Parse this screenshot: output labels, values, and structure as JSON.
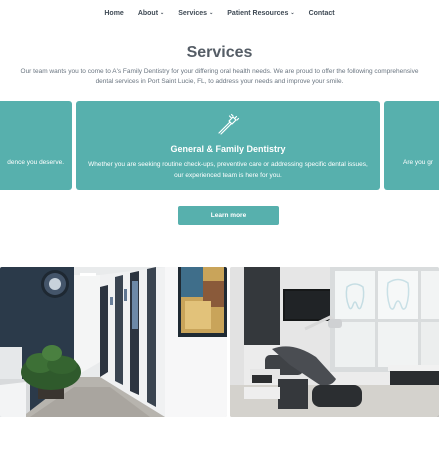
{
  "nav": {
    "items": [
      {
        "label": "Home",
        "has_dropdown": false
      },
      {
        "label": "About",
        "has_dropdown": true
      },
      {
        "label": "Services",
        "has_dropdown": true
      },
      {
        "label": "Patient Resources",
        "has_dropdown": true
      },
      {
        "label": "Contact",
        "has_dropdown": false
      }
    ],
    "chevron": "⌄"
  },
  "services": {
    "title": "Services",
    "intro": "Our team wants you to come to A's Family Dentistry for your differing oral health needs. We are proud to offer the following comprehensive dental services in Port Saint Lucie, FL, to address your needs and improve your smile.",
    "cards": {
      "left_partial_text": "dence you deserve.",
      "main": {
        "icon": "toothbrush-icon",
        "title": "General & Family Dentistry",
        "description": "Whether you are seeking routine check-ups, preventive care or addressing specific dental issues, our experienced team is here for you."
      },
      "right_partial_text": "Are you gr"
    },
    "learn_more_label": "Learn more"
  },
  "colors": {
    "accent": "#57b0ad",
    "nav_text": "#3f4a55",
    "heading": "#555d66",
    "body_text": "#6a7580"
  },
  "photos": [
    {
      "name": "office-hallway-photo"
    },
    {
      "name": "dental-operatory-photo"
    }
  ]
}
